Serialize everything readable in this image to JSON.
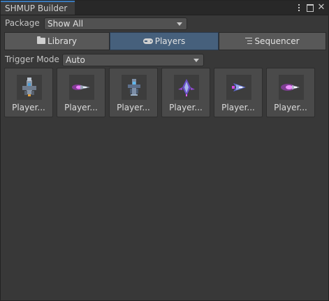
{
  "window": {
    "title": "SHMUP Builder",
    "controls": [
      "more-options",
      "maximize",
      "close"
    ]
  },
  "package": {
    "label": "Package",
    "selected": "Show All"
  },
  "tabs": [
    {
      "label": "Library",
      "icon": "folder-icon",
      "active": false
    },
    {
      "label": "Players",
      "icon": "gamepad-icon",
      "active": true
    },
    {
      "label": "Sequencer",
      "icon": "list-icon",
      "active": false
    }
  ],
  "trigger": {
    "label": "Trigger Mode",
    "selected": "Auto"
  },
  "players": [
    {
      "label": "Player...",
      "sprite": "ship-gray-cannon"
    },
    {
      "label": "Player...",
      "sprite": "ship-purple-thruster"
    },
    {
      "label": "Player...",
      "sprite": "ship-blue-fighter"
    },
    {
      "label": "Player...",
      "sprite": "ship-purple-dart"
    },
    {
      "label": "Player...",
      "sprite": "ship-blue-wing"
    },
    {
      "label": "Player...",
      "sprite": "ship-purple-glow"
    }
  ],
  "colors": {
    "accent": "#3a79bb",
    "active_tab": "#46607c",
    "background": "#383838"
  }
}
